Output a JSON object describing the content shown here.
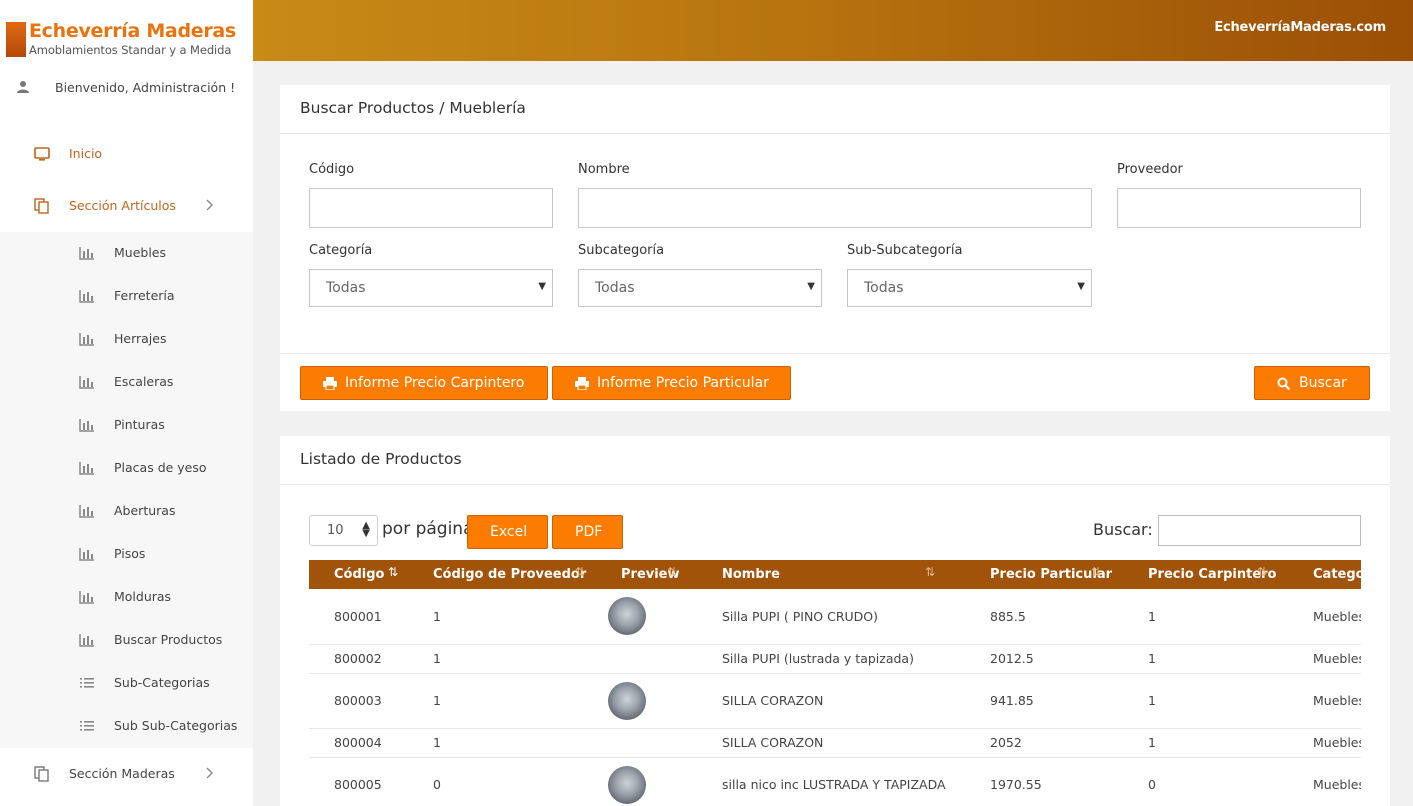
{
  "header": {
    "site_link": "EcheverríaMaderas.com"
  },
  "brand": {
    "title": "Echeverría Maderas",
    "subtitle": "Amoblamientos Standar y a Medida"
  },
  "user": {
    "welcome": "Bienvenido, Administración !"
  },
  "sidebar": {
    "items": [
      {
        "label": "Inicio",
        "icon": "monitor-icon"
      },
      {
        "label": "Sección Artículos",
        "icon": "copy-icon"
      }
    ],
    "submenu": [
      {
        "label": "Muebles",
        "icon": "bar-chart-icon"
      },
      {
        "label": "Ferretería",
        "icon": "bar-chart-icon"
      },
      {
        "label": "Herrajes",
        "icon": "bar-chart-icon"
      },
      {
        "label": "Escaleras",
        "icon": "bar-chart-icon"
      },
      {
        "label": "Pinturas",
        "icon": "bar-chart-icon"
      },
      {
        "label": "Placas de yeso",
        "icon": "bar-chart-icon"
      },
      {
        "label": "Aberturas",
        "icon": "bar-chart-icon"
      },
      {
        "label": "Pisos",
        "icon": "bar-chart-icon"
      },
      {
        "label": "Molduras",
        "icon": "bar-chart-icon"
      },
      {
        "label": "Buscar Productos",
        "icon": "bar-chart-icon"
      },
      {
        "label": "Sub-Categorias",
        "icon": "list-icon"
      },
      {
        "label": "Sub Sub-Categorias",
        "icon": "list-icon"
      }
    ],
    "bottom_item": {
      "label": "Sección Maderas",
      "icon": "copy-icon"
    }
  },
  "search_panel": {
    "title": "Buscar Productos / Mueblería",
    "codigo_label": "Código",
    "codigo_value": "",
    "nombre_label": "Nombre",
    "nombre_value": "",
    "proveedor_label": "Proveedor",
    "proveedor_value": "",
    "categoria_label": "Categoría",
    "categoria_value": "Todas",
    "subcategoria_label": "Subcategoría",
    "subcategoria_value": "Todas",
    "subsubcategoria_label": "Sub-Subcategoría",
    "subsubcategoria_value": "Todas",
    "btn_carpintero": "Informe Precio Carpintero",
    "btn_particular": "Informe Precio Particular",
    "btn_buscar": "Buscar"
  },
  "list_panel": {
    "title": "Listado de Productos",
    "page_length": "10",
    "page_length_label": "por página",
    "btn_excel": "Excel",
    "btn_pdf": "PDF",
    "search_label": "Buscar:",
    "search_value": "",
    "columns": [
      "Código",
      "Código de Proveedor",
      "Preview",
      "Nombre",
      "Precio Particular",
      "Precio Carpintero",
      "Categoría"
    ],
    "rows": [
      {
        "codigo": "800001",
        "proveedor": "1",
        "preview": true,
        "nombre": "Silla PUPI ( PINO CRUDO)",
        "particular": "885.5",
        "carpintero": "1",
        "categoria": "Muebles"
      },
      {
        "codigo": "800002",
        "proveedor": "1",
        "preview": false,
        "nombre": "Silla PUPI (lustrada y tapizada)",
        "particular": "2012.5",
        "carpintero": "1",
        "categoria": "Muebles"
      },
      {
        "codigo": "800003",
        "proveedor": "1",
        "preview": true,
        "nombre": "SILLA CORAZON",
        "particular": "941.85",
        "carpintero": "1",
        "categoria": "Muebles"
      },
      {
        "codigo": "800004",
        "proveedor": "1",
        "preview": false,
        "nombre": "SILLA CORAZON",
        "particular": "2052",
        "carpintero": "1",
        "categoria": "Muebles"
      },
      {
        "codigo": "800005",
        "proveedor": "0",
        "preview": true,
        "nombre": "silla nico inc LUSTRADA Y TAPIZADA",
        "particular": "1970.55",
        "carpintero": "0",
        "categoria": "Muebles"
      }
    ]
  },
  "colors": {
    "accent": "#fb7c00",
    "header_start": "#c98a17",
    "header_end": "#9b4f06",
    "table_head": "#a1530a",
    "nav_accent": "#c0631d"
  }
}
